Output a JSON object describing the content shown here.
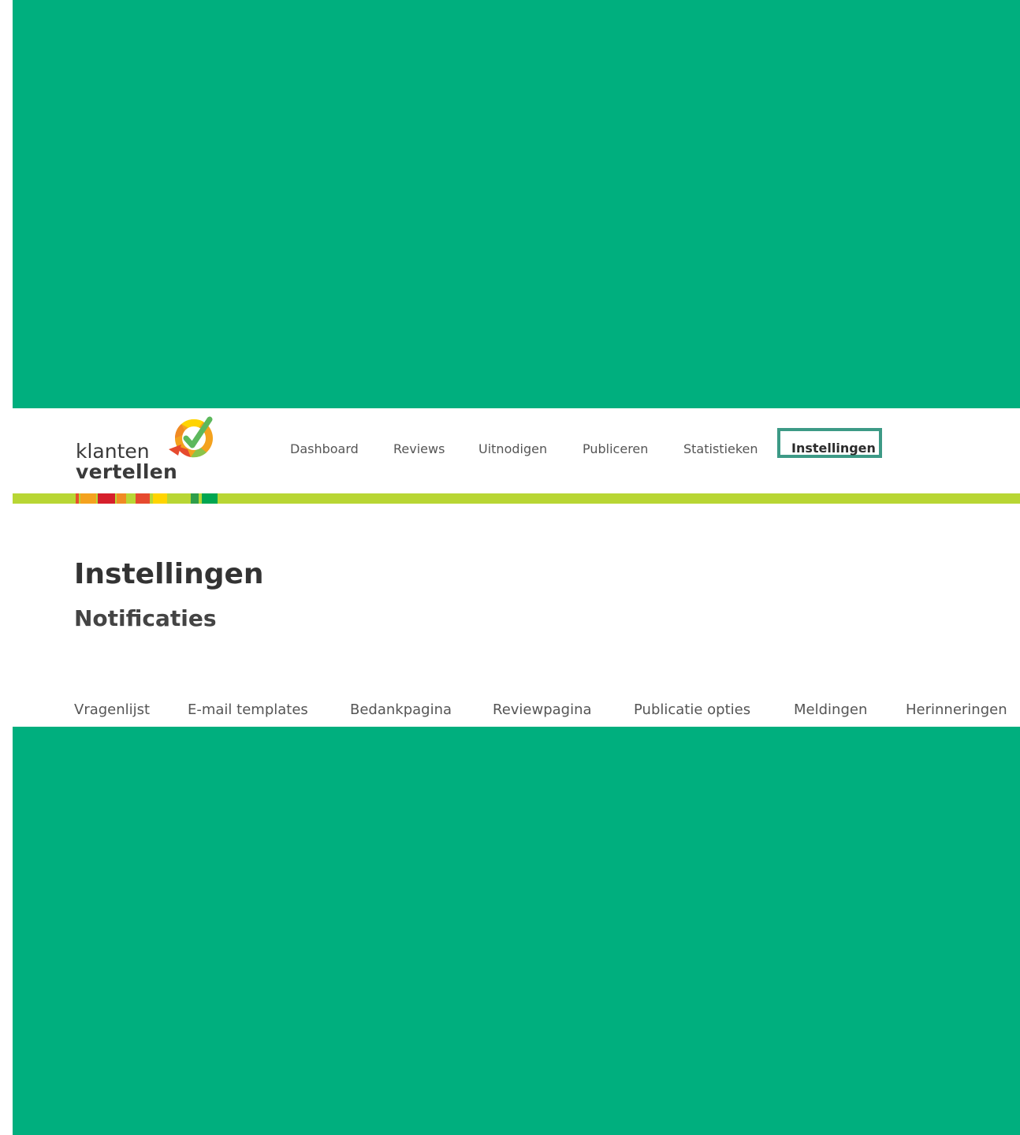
{
  "brand": {
    "name_line1": "klanten",
    "name_line2": "vertellen",
    "stripe_colors": [
      "#e8502a",
      "#f4a21e",
      "#d61f2b",
      "#f08a24",
      "#e64a2e",
      "#ffd400",
      "#b8d634",
      "#2e9e4a",
      "#00a651"
    ],
    "accent": "#b8d634",
    "background": "#00af7e",
    "active_border": "#3d9a86"
  },
  "topnav": {
    "items": [
      {
        "label": "Dashboard"
      },
      {
        "label": "Reviews"
      },
      {
        "label": "Uitnodigen"
      },
      {
        "label": "Publiceren"
      },
      {
        "label": "Statistieken"
      },
      {
        "label": "Instellingen",
        "active": true
      }
    ]
  },
  "page": {
    "title": "Instellingen",
    "subtitle": "Notificaties"
  },
  "subnav": {
    "items": [
      {
        "label": "Vragenlijst"
      },
      {
        "label": "E-mail templates"
      },
      {
        "label": "Bedankpagina"
      },
      {
        "label": "Reviewpagina"
      },
      {
        "label": "Publicatie opties"
      },
      {
        "label": "Meldingen"
      },
      {
        "label": "Herinneringen"
      }
    ]
  }
}
